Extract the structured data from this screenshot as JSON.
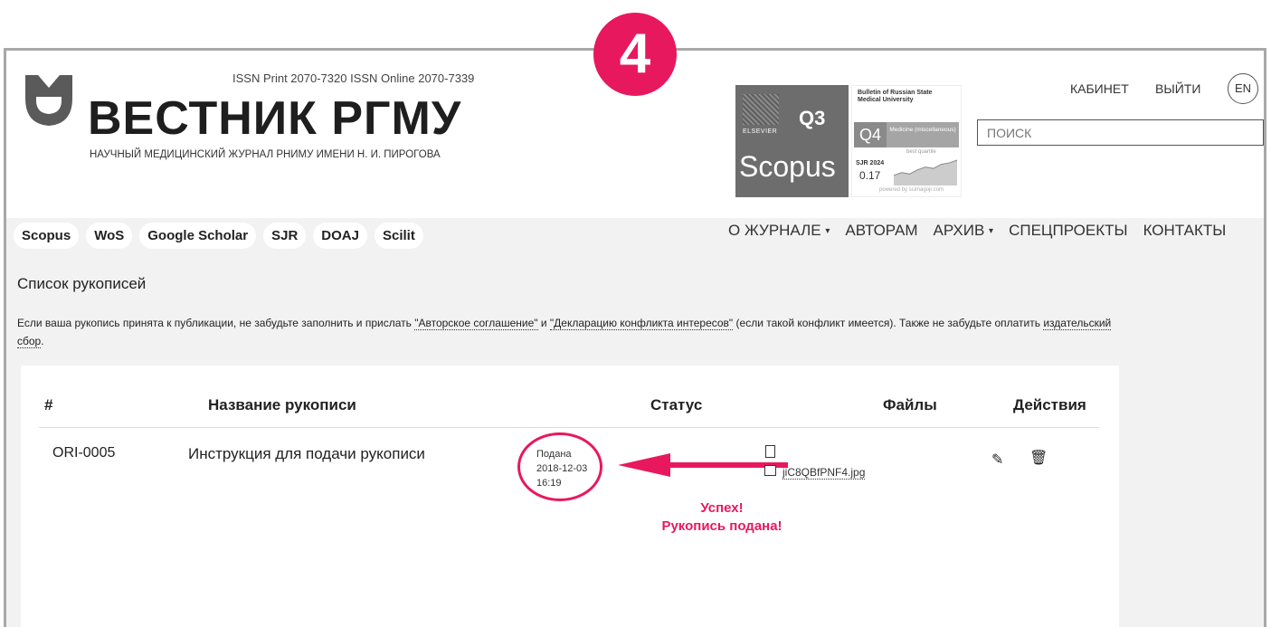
{
  "step_number": "4",
  "header": {
    "issn": "ISSN Print 2070-7320   ISSN Online 2070-7339",
    "brand": "ВЕСТНИК РГМУ",
    "subtitle": "НАУЧНЫЙ МЕДИЦИНСКИЙ ЖУРНАЛ РНИМУ ИМЕНИ Н. И. ПИРОГОВА",
    "scopus": {
      "quartile": "Q3",
      "publisher": "ELSEVIER",
      "word": "Scopus"
    },
    "sjr": {
      "journal": "Bulletin of Russian State Medical University",
      "quartile": "Q4",
      "category": "Medicine (miscellaneous)",
      "best": "best quartile",
      "year_label": "SJR 2024",
      "value": "0.17",
      "powered": "powered by scimagojr.com",
      "trend": [
        0.06,
        0.08,
        0.07,
        0.1,
        0.12,
        0.11,
        0.14,
        0.15,
        0.17
      ]
    },
    "account_link": "КАБИНЕТ",
    "logout_link": "ВЫЙТИ",
    "lang_button": "EN",
    "search_placeholder": "ПОИСК"
  },
  "indexes": [
    "Scopus",
    "WoS",
    "Google Scholar",
    "SJR",
    "DOAJ",
    "Scilit"
  ],
  "nav": {
    "about": "О ЖУРНАЛЕ",
    "authors": "АВТОРАМ",
    "archive": "АРХИВ",
    "special": "СПЕЦПРОЕКТЫ",
    "contacts": "КОНТАКТЫ",
    "caret": "▾"
  },
  "page": {
    "title": "Список рукописей",
    "notice_1": "Если ваша рукопись принята к публикации, не забудьте заполнить и прислать ",
    "notice_link_1": "\"Авторское соглашение\"",
    "notice_2": " и ",
    "notice_link_2": "\"Декларацию конфликта интересов\"",
    "notice_3": " (если такой конфликт имеется). Также не забудьте оплатить ",
    "notice_link_3": "издательский сбор",
    "notice_4": "."
  },
  "table": {
    "headers": {
      "id": "#",
      "name": "Название рукописи",
      "status": "Статус",
      "files": "Файлы",
      "actions": "Действия"
    },
    "row": {
      "id": "ORI-0005",
      "name": "Инструкция для подачи рукописи",
      "status_label": "Подана",
      "status_date": "2018-12-03",
      "status_time": "16:19",
      "file_name": "jiC8QBfPNF4.jpg",
      "edit_icon": "✎",
      "delete_icon": "🗑"
    }
  },
  "annotation": {
    "line1": "Успех!",
    "line2": "Рукопись подана!",
    "accent": "#e8185e"
  }
}
